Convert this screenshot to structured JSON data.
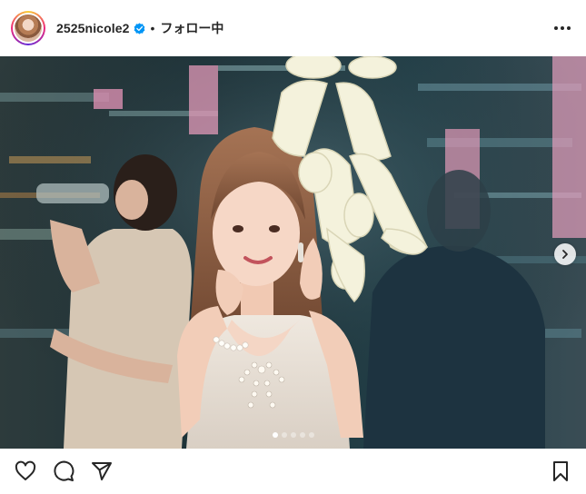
{
  "post": {
    "username": "2525nicole2",
    "separator": "•",
    "follow_status": "フォロー中"
  },
  "icons": {
    "avatar": "profile-photo",
    "verified": "verified-badge-icon",
    "more": "more-options-icon",
    "next": "chevron-right-icon",
    "like": "heart-icon",
    "comment": "comment-icon",
    "share": "paper-plane-icon",
    "save": "bookmark-icon"
  },
  "carousel": {
    "total_slides": 5,
    "current_slide": 1
  },
  "colors": {
    "verified_blue": "#0095f6",
    "text": "#262626"
  }
}
